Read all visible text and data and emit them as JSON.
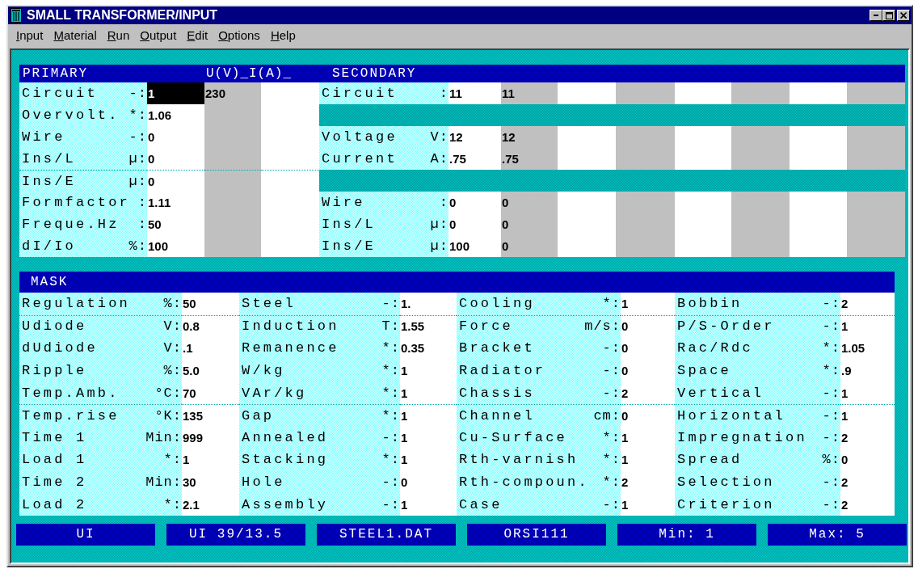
{
  "window": {
    "title": "SMALL TRANSFORMER/INPUT"
  },
  "menu": [
    {
      "label": "Input",
      "underline_first": true
    },
    {
      "label": "Material",
      "underline_first": true
    },
    {
      "label": "Run",
      "underline_first": true
    },
    {
      "label": "Output",
      "underline_first": true
    },
    {
      "label": "Edit",
      "underline_first": true
    },
    {
      "label": "Options",
      "underline_first": true
    },
    {
      "label": "Help",
      "underline_first": true
    }
  ],
  "windings": {
    "header": {
      "primary": "PRIMARY",
      "columns": "U(V)_I(A)_",
      "secondary": "SECONDARY"
    },
    "rows": [
      {
        "primary": {
          "label": "Circuit",
          "unit": "-:",
          "separated": false,
          "cells": [
            {
              "value": "1",
              "selected": true
            },
            {
              "value": "230",
              "selected": false
            },
            {
              "selected": false
            }
          ]
        },
        "secondary": {
          "kind": "field",
          "label": "Circuit",
          "unit": ":",
          "cells": [
            "11",
            "11"
          ]
        }
      },
      {
        "primary": {
          "label": "Overvolt.",
          "unit": "*:",
          "separated": false,
          "cells": [
            {
              "value": "1.06",
              "selected": false
            },
            {
              "selected": false
            },
            {
              "selected": false
            }
          ]
        },
        "secondary": {
          "kind": "band"
        }
      },
      {
        "primary": {
          "label": "Wire",
          "unit": "-:",
          "separated": false,
          "cells": [
            {
              "value": "0",
              "selected": false
            },
            {
              "selected": false
            },
            {
              "selected": false
            }
          ]
        },
        "secondary": {
          "kind": "field",
          "label": "Voltage",
          "unit": "V:",
          "cells": [
            "12",
            "12"
          ]
        }
      },
      {
        "primary": {
          "label": "Ins/L",
          "unit": "µ:",
          "separated": false,
          "cells": [
            {
              "value": "0",
              "selected": false
            },
            {
              "selected": false
            },
            {
              "selected": false
            }
          ]
        },
        "secondary": {
          "kind": "field",
          "label": "Current",
          "unit": "A:",
          "cells": [
            ".75",
            ".75"
          ]
        }
      },
      {
        "primary": {
          "label": "Ins/E",
          "unit": "µ:",
          "separated": true,
          "cells": [
            {
              "value": "0",
              "selected": false
            },
            {
              "selected": false
            },
            {
              "selected": false
            }
          ]
        },
        "secondary": {
          "kind": "band"
        }
      },
      {
        "primary": {
          "label": "Formfactor",
          "unit": ":",
          "separated": false,
          "cells": [
            {
              "value": "1.11",
              "selected": false
            },
            {
              "selected": false
            },
            {
              "selected": false
            }
          ]
        },
        "secondary": {
          "kind": "field",
          "label": "Wire",
          "unit": ":",
          "cells": [
            "0",
            "0"
          ]
        }
      },
      {
        "primary": {
          "label": "Freque.Hz",
          "unit": ":",
          "separated": false,
          "cells": [
            {
              "value": "50",
              "selected": false
            },
            {
              "selected": false
            },
            {
              "selected": false
            }
          ]
        },
        "secondary": {
          "kind": "field",
          "label": "Ins/L",
          "unit": "µ:",
          "cells": [
            "0",
            "0"
          ]
        }
      },
      {
        "primary": {
          "label": "dI/Io",
          "unit": "%:",
          "separated": false,
          "cells": [
            {
              "value": "100",
              "selected": false
            },
            {
              "selected": false
            },
            {
              "selected": false
            }
          ]
        },
        "secondary": {
          "kind": "field",
          "label": "Ins/E",
          "unit": "µ:",
          "cells": [
            "100",
            "0"
          ]
        }
      }
    ]
  },
  "mask": {
    "title": "MASK",
    "rows": [
      {
        "separated": false,
        "fields": [
          {
            "label": "Regulation",
            "unit": "%:",
            "value": "50"
          },
          {
            "label": "Steel",
            "unit": "-:",
            "value": "1."
          },
          {
            "label": "Cooling",
            "unit": "*:",
            "value": "1"
          },
          {
            "label": "Bobbin",
            "unit": "-:",
            "value": "2"
          }
        ]
      },
      {
        "separated": true,
        "fields": [
          {
            "label": "Udiode",
            "unit": "V:",
            "value": "0.8"
          },
          {
            "label": "Induction",
            "unit": "T:",
            "value": "1.55"
          },
          {
            "label": "Force",
            "unit": "m/s:",
            "value": "0"
          },
          {
            "label": "P/S-Order",
            "unit": "-:",
            "value": "1"
          }
        ]
      },
      {
        "separated": false,
        "fields": [
          {
            "label": "dUdiode",
            "unit": "V:",
            "value": ".1"
          },
          {
            "label": "Remanence",
            "unit": "*:",
            "value": "0.35"
          },
          {
            "label": "Bracket",
            "unit": "-:",
            "value": "0"
          },
          {
            "label": "Rac/Rdc",
            "unit": "*:",
            "value": "1.05"
          }
        ]
      },
      {
        "separated": false,
        "fields": [
          {
            "label": "Ripple",
            "unit": "%:",
            "value": "5.0"
          },
          {
            "label": "W/kg",
            "unit": "*:",
            "value": "1"
          },
          {
            "label": "Radiator",
            "unit": "-:",
            "value": "0"
          },
          {
            "label": "Space",
            "unit": "*:",
            "value": ".9"
          }
        ]
      },
      {
        "separated": false,
        "fields": [
          {
            "label": "Temp.Amb.",
            "unit": "°C:",
            "value": "70"
          },
          {
            "label": "VAr/kg",
            "unit": "*:",
            "value": "1"
          },
          {
            "label": "Chassis",
            "unit": "-:",
            "value": "2"
          },
          {
            "label": "Vertical",
            "unit": "-:",
            "value": "1"
          }
        ]
      },
      {
        "separated": true,
        "fields": [
          {
            "label": "Temp.rise",
            "unit": "°K:",
            "value": "135"
          },
          {
            "label": "Gap",
            "unit": "*:",
            "value": "1"
          },
          {
            "label": "Channel",
            "unit": "cm:",
            "value": "0"
          },
          {
            "label": "Horizontal",
            "unit": "-:",
            "value": "1"
          }
        ]
      },
      {
        "separated": false,
        "fields": [
          {
            "label": "Time 1",
            "unit": "Min:",
            "value": "999"
          },
          {
            "label": "Annealed",
            "unit": "-:",
            "value": "1"
          },
          {
            "label": "Cu-Surface",
            "unit": "*:",
            "value": "1"
          },
          {
            "label": "Impregnation",
            "unit": "-:",
            "value": "2"
          }
        ]
      },
      {
        "separated": false,
        "fields": [
          {
            "label": "Load 1",
            "unit": "*:",
            "value": "1"
          },
          {
            "label": "Stacking",
            "unit": "*:",
            "value": "1"
          },
          {
            "label": "Rth-varnish",
            "unit": "*:",
            "value": "1"
          },
          {
            "label": "Spread",
            "unit": "%:",
            "value": "0"
          }
        ]
      },
      {
        "separated": false,
        "fields": [
          {
            "label": "Time 2",
            "unit": "Min:",
            "value": "30"
          },
          {
            "label": "Hole",
            "unit": "-:",
            "value": "0"
          },
          {
            "label": "Rth-compoun.",
            "unit": "*:",
            "value": "2"
          },
          {
            "label": "Selection",
            "unit": "-:",
            "value": "2"
          }
        ]
      },
      {
        "separated": false,
        "fields": [
          {
            "label": "Load 2",
            "unit": "*:",
            "value": "2.1"
          },
          {
            "label": "Assembly",
            "unit": "-:",
            "value": "1"
          },
          {
            "label": "Case",
            "unit": "-:",
            "value": "1"
          },
          {
            "label": "Criterion",
            "unit": "-:",
            "value": "2"
          }
        ]
      }
    ]
  },
  "status_bar": [
    {
      "text": "UI"
    },
    {
      "text": "UI 39/13.5"
    },
    {
      "text": "STEEL1.DAT"
    },
    {
      "text": "ORSI111"
    },
    {
      "text": "Min: 1"
    },
    {
      "text": "Max: 5"
    }
  ]
}
